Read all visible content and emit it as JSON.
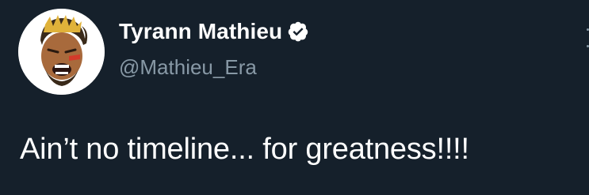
{
  "tweet": {
    "display_name": "Tyrann Mathieu",
    "handle": "@Mathieu_Era",
    "text": "Ain’t no timeline... for greatness!!!!"
  },
  "icons": {
    "avatar": "cartoon-avatar",
    "verified": "verified-badge-icon",
    "more": "more-options-icon"
  },
  "colors": {
    "background": "#15202b",
    "primary_text": "#ffffff",
    "secondary_text": "#8899a6"
  }
}
